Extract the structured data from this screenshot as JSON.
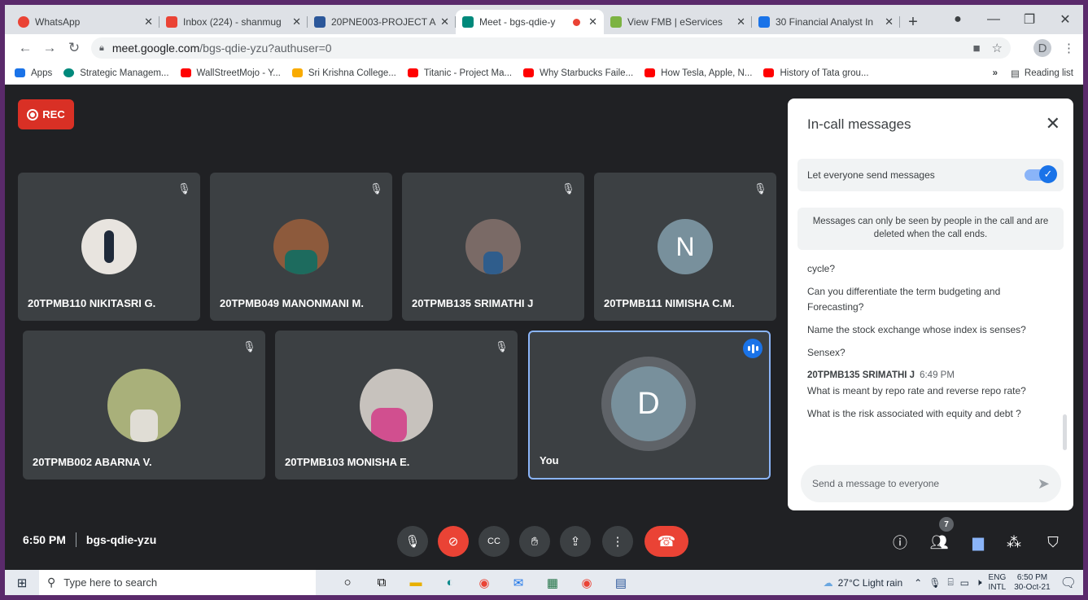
{
  "browser": {
    "tabs": [
      {
        "title": "WhatsApp",
        "color": "#25d366"
      },
      {
        "title": "Inbox (224) - shanmug",
        "color": "#ea4335"
      },
      {
        "title": "20PNE003-PROJECT A",
        "color": "#2b579a"
      },
      {
        "title": "Meet - bgs-qdie-y",
        "color": "#00897b"
      },
      {
        "title": "View FMB | eServices",
        "color": "#7cb342"
      },
      {
        "title": "30 Financial Analyst In",
        "color": "#1a73e8"
      }
    ],
    "url_host": "meet.google.com",
    "url_path": "/bgs-qdie-yzu?authuser=0",
    "profile_initial": "D",
    "bookmarks": [
      {
        "label": "Apps",
        "color": "#1a73e8"
      },
      {
        "label": "Strategic Managem...",
        "color": "#00897b"
      },
      {
        "label": "WallStreetMojo - Y...",
        "color": "#ff0000"
      },
      {
        "label": "Sri Krishna College...",
        "color": "#f9ab00"
      },
      {
        "label": "Titanic - Project Ma...",
        "color": "#ff0000"
      },
      {
        "label": "Why Starbucks Faile...",
        "color": "#ff0000"
      },
      {
        "label": "How Tesla, Apple, N...",
        "color": "#ff0000"
      },
      {
        "label": "History of Tata grou...",
        "color": "#ff0000"
      }
    ],
    "reading_list": "Reading list"
  },
  "meet": {
    "rec_label": "REC",
    "participants": [
      {
        "name": "20TPMB110 NIKITASRI G.",
        "avatar_color": "#e8e4df"
      },
      {
        "name": "20TPMB049 MANONMANI M.",
        "avatar_color": "#8d5a3c"
      },
      {
        "name": "20TPMB135 SRIMATHI J",
        "avatar_color": "#7a6a66"
      },
      {
        "name": "20TPMB111 NIMISHA C.M.",
        "avatar_letter": "N"
      },
      {
        "name": "20TPMB002 ABARNA V.",
        "avatar_color": "#a9b07a"
      },
      {
        "name": "20TPMB103 MONISHA E.",
        "avatar_color": "#c7c2bd"
      },
      {
        "name": "You",
        "avatar_letter": "D"
      }
    ],
    "time": "6:50 PM",
    "meeting_code": "bgs-qdie-yzu",
    "people_count": "7"
  },
  "chat": {
    "title": "In-call messages",
    "toggle_label": "Let everyone send messages",
    "notice": "Messages can only be seen by people in the call and are deleted when the call ends.",
    "messages_top": [
      "cycle?",
      "Can you differentiate the term budgeting and Forecasting?",
      "Name the stock exchange whose index is senses?",
      "Sensex?"
    ],
    "sender": "20TPMB135 SRIMATHI J",
    "sender_time": "6:49 PM",
    "messages_bottom": [
      "What is meant by repo rate and reverse repo rate?",
      "What is the risk associated with equity and debt ?"
    ],
    "input_placeholder": "Send a message to everyone"
  },
  "taskbar": {
    "search_placeholder": "Type here to search",
    "weather": "27°C  Light rain",
    "lang_top": "ENG",
    "lang_bottom": "INTL",
    "clock_time": "6:50 PM",
    "clock_date": "30-Oct-21"
  }
}
